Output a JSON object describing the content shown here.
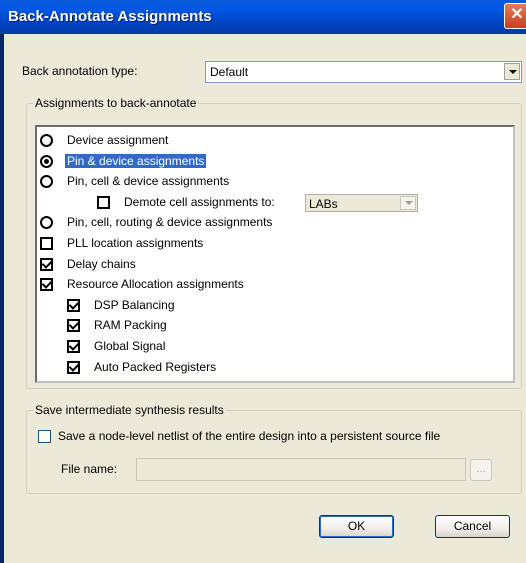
{
  "window": {
    "title": "Back-Annotate Assignments",
    "close_glyph": "✕"
  },
  "type": {
    "label": "Back annotation type:",
    "value": "Default"
  },
  "assignments": {
    "group_title": "Assignments to back-annotate",
    "items": [
      {
        "kind": "radio",
        "checked": false,
        "label": "Device assignment"
      },
      {
        "kind": "radio",
        "checked": true,
        "selected": true,
        "label": "Pin & device assignments"
      },
      {
        "kind": "radio",
        "checked": false,
        "label": "Pin, cell & device assignments"
      },
      {
        "kind": "checkbox",
        "checked": false,
        "label": "Demote cell assignments to:",
        "combo_value": "LABs"
      },
      {
        "kind": "radio",
        "checked": false,
        "label": "Pin, cell, routing & device assignments"
      },
      {
        "kind": "checkbox",
        "checked": false,
        "label": "PLL location assignments"
      },
      {
        "kind": "checkbox",
        "checked": true,
        "label": "Delay chains"
      },
      {
        "kind": "checkbox",
        "checked": true,
        "label": "Resource Allocation assignments"
      },
      {
        "kind": "checkbox",
        "checked": true,
        "label": "DSP Balancing"
      },
      {
        "kind": "checkbox",
        "checked": true,
        "label": "RAM Packing"
      },
      {
        "kind": "checkbox",
        "checked": true,
        "label": "Global Signal"
      },
      {
        "kind": "checkbox",
        "checked": true,
        "label": "Auto Packed Registers"
      }
    ]
  },
  "synthesis": {
    "group_title": "Save intermediate synthesis results",
    "save_label": "Save a node-level netlist of the entire design into a persistent source file",
    "save_checked": false,
    "file_label": "File name:",
    "file_value": "",
    "browse_label": "..."
  },
  "buttons": {
    "ok": "OK",
    "cancel": "Cancel"
  }
}
